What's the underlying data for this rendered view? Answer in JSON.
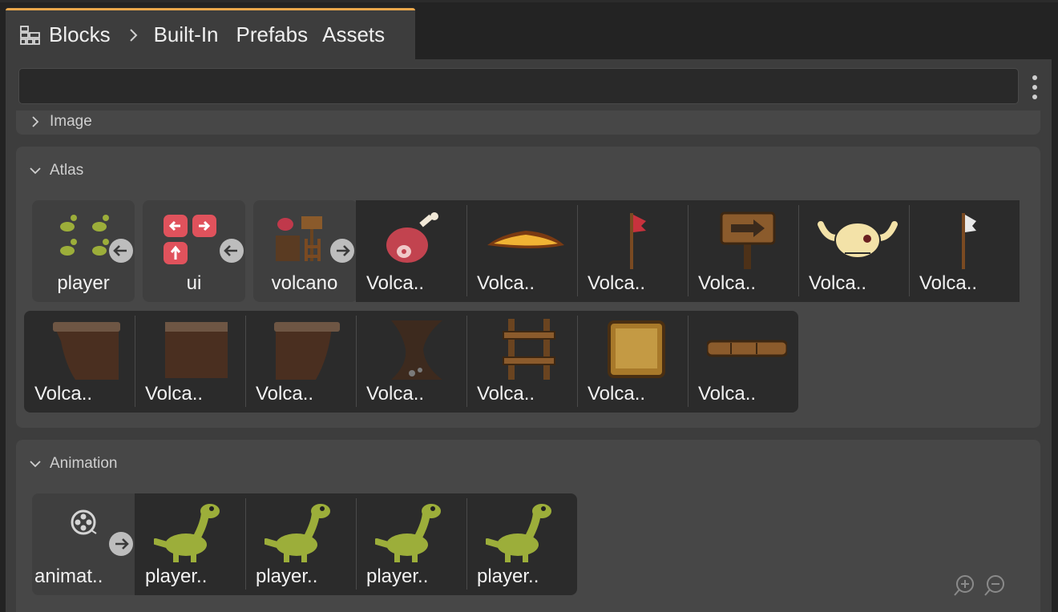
{
  "tab": {
    "breadcrumb": [
      "Blocks",
      "Built-In",
      "Prefabs",
      "Assets"
    ],
    "icon": "blocks-grid-icon"
  },
  "search": {
    "value": "",
    "placeholder": ""
  },
  "sections": {
    "image": {
      "title": "Image",
      "expanded": false
    },
    "atlas": {
      "title": "Atlas",
      "expanded": true,
      "row1": [
        {
          "label": "player",
          "kind": "atlas-source",
          "icon": "dino-group-icon"
        },
        {
          "label": "ui",
          "kind": "atlas-source",
          "icon": "ui-buttons-icon"
        },
        {
          "label": "volcano",
          "kind": "atlas-source",
          "icon": "volcano-set-icon"
        },
        {
          "label": "Volca..",
          "icon": "meat-icon"
        },
        {
          "label": "Volca..",
          "icon": "lava-icon"
        },
        {
          "label": "Volca..",
          "icon": "red-flag-icon"
        },
        {
          "label": "Volca..",
          "icon": "sign-arrow-icon"
        },
        {
          "label": "Volca..",
          "icon": "skull-icon"
        },
        {
          "label": "Volca..",
          "icon": "white-flag-icon"
        }
      ],
      "row2": [
        {
          "label": "Volca..",
          "icon": "ground-left-icon"
        },
        {
          "label": "Volca..",
          "icon": "ground-middle-icon"
        },
        {
          "label": "Volca..",
          "icon": "ground-right-icon"
        },
        {
          "label": "Volca..",
          "icon": "rock-pillar-icon"
        },
        {
          "label": "Volca..",
          "icon": "ladder-icon"
        },
        {
          "label": "Volca..",
          "icon": "sand-block-icon"
        },
        {
          "label": "Volca..",
          "icon": "wood-plank-icon"
        }
      ]
    },
    "animation": {
      "title": "Animation",
      "expanded": true,
      "items": [
        {
          "label": "animat..",
          "kind": "animation-source",
          "icon": "film-reel-icon"
        },
        {
          "label": "player..",
          "icon": "dino-icon"
        },
        {
          "label": "player..",
          "icon": "dino-icon"
        },
        {
          "label": "player..",
          "icon": "dino-icon"
        },
        {
          "label": "player..",
          "icon": "dino-icon"
        }
      ]
    }
  },
  "zoom": {
    "in_icon": "zoom-in-icon",
    "out_icon": "zoom-out-icon"
  },
  "colors": {
    "accent": "#e9a74c",
    "panel": "#3d3d3d",
    "section": "#474747",
    "tile": "#2b2b2b"
  }
}
